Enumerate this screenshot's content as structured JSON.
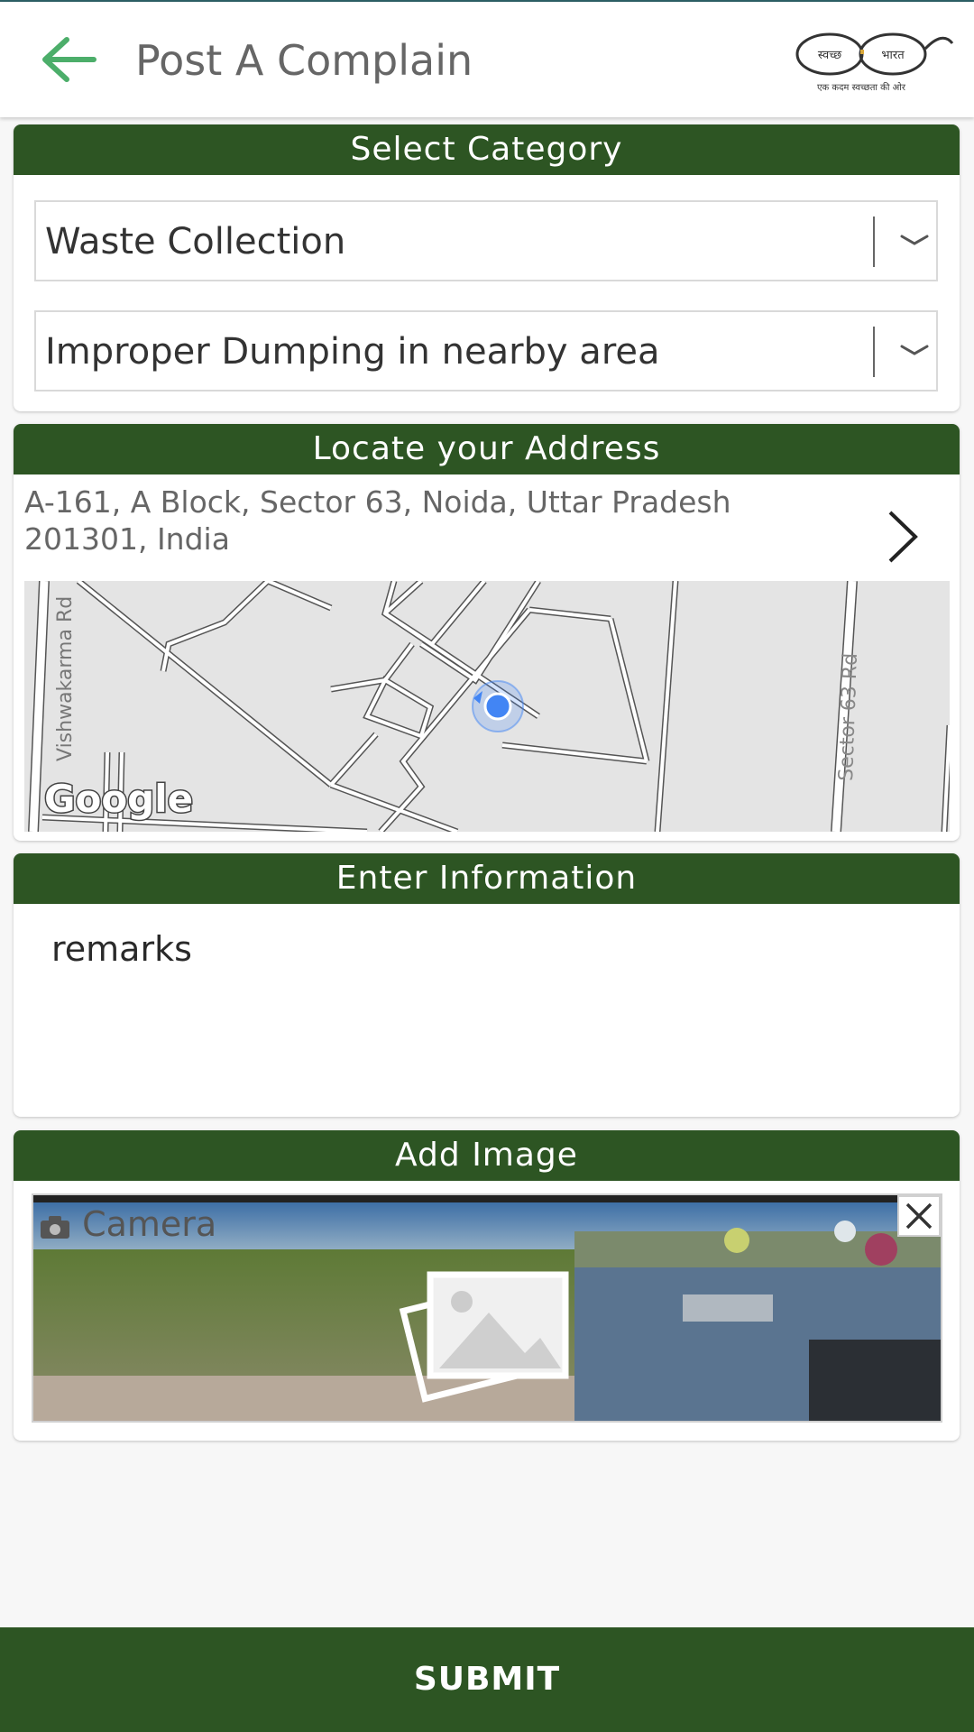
{
  "app_bar": {
    "title": "Post A Complain",
    "back_icon": "arrow-left-icon",
    "logo": {
      "text_left": "स्वच्छ",
      "text_right": "भारत",
      "tagline": "एक कदम स्वच्छता की ओर"
    }
  },
  "category_section": {
    "header": "Select Category",
    "category_value": "Waste Collection",
    "subcategory_value": "Improper Dumping in nearby area"
  },
  "address_section": {
    "header": "Locate your Address",
    "address": "A-161, A Block, Sector 63, Noida, Uttar Pradesh 201301, India",
    "map": {
      "road_label_left": "Vishwakarma Rd",
      "road_label_right": "Sector 63 Rd",
      "brand": "Google"
    }
  },
  "info_section": {
    "header": "Enter Information",
    "remarks": "remarks"
  },
  "image_section": {
    "header": "Add Image",
    "camera_label": "Camera"
  },
  "submit_label": "SUBMIT",
  "colors": {
    "header_green": "#2d5523",
    "back_arrow": "#4cae6a",
    "location_dot": "#4285f4"
  }
}
